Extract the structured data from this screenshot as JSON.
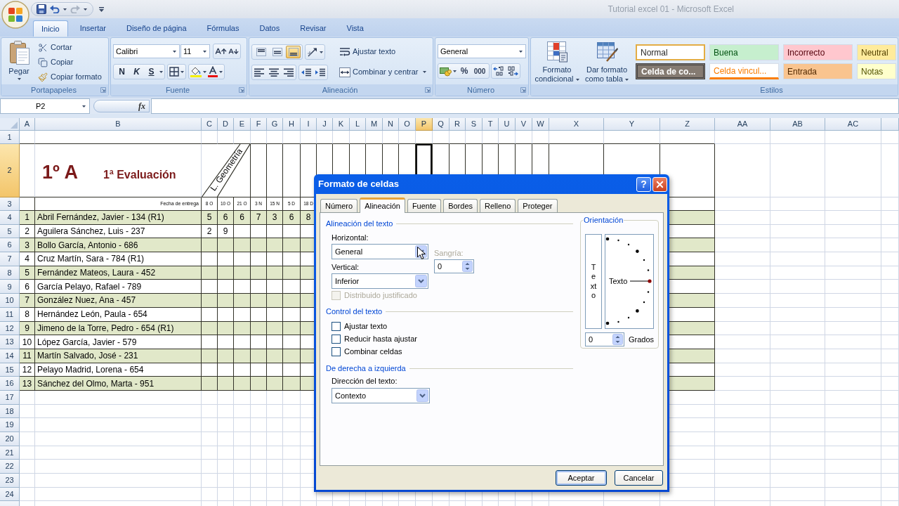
{
  "window": {
    "title": "Tutorial excel 01 - Microsoft Excel"
  },
  "ribbon_tabs": [
    {
      "label": "Inicio",
      "selected": true
    },
    {
      "label": "Insertar",
      "selected": false
    },
    {
      "label": "Diseño de página",
      "selected": false
    },
    {
      "label": "Fórmulas",
      "selected": false
    },
    {
      "label": "Datos",
      "selected": false
    },
    {
      "label": "Revisar",
      "selected": false
    },
    {
      "label": "Vista",
      "selected": false
    }
  ],
  "ribbon": {
    "clipboard": {
      "label": "Portapapeles",
      "paste": "Pegar",
      "tools": [
        "Cortar",
        "Copiar",
        "Copiar formato"
      ]
    },
    "font": {
      "label": "Fuente",
      "font_name": "Calibri",
      "font_size": "11",
      "styles": [
        {
          "label": "N",
          "kind": "bold"
        },
        {
          "label": "K",
          "kind": "italic"
        },
        {
          "label": "S",
          "kind": "underline"
        }
      ]
    },
    "alignment": {
      "label": "Alineación",
      "vertical": [
        {
          "kind": "top",
          "selected": false
        },
        {
          "kind": "middle",
          "selected": false
        },
        {
          "kind": "bottom",
          "selected": true
        }
      ],
      "wrap_text": "Ajustar texto",
      "merge": "Combinar y centrar"
    },
    "number": {
      "label": "Número",
      "format": "General",
      "percent": "%",
      "thousands": "000"
    },
    "styles": {
      "label": "Estilos",
      "conditional": "Formato condicional",
      "as_table": "Dar formato como tabla",
      "cell_styles": [
        {
          "label": "Normal",
          "kind": "fill",
          "color": "#ffffff",
          "selected": true
        },
        {
          "label": "Buena",
          "kind": "fill",
          "color": "#c6efce",
          "selected": false
        },
        {
          "label": "Incorrecto",
          "kind": "fill",
          "color": "#ffc7ce",
          "selected": false
        },
        {
          "label": "Neutral",
          "kind": "fill",
          "color": "#ffeb9c",
          "selected": false
        },
        {
          "label": "Celda de co...",
          "kind": "check",
          "color": "#857b72",
          "selected": false
        },
        {
          "label": "Celda vincul...",
          "kind": "linked",
          "color": "#fa7d00",
          "selected": false
        },
        {
          "label": "Entrada",
          "kind": "fill",
          "color": "#f9c48f",
          "selected": false
        },
        {
          "label": "Notas",
          "kind": "fill",
          "color": "#ffffcc",
          "selected": false
        }
      ]
    }
  },
  "formula_bar": {
    "name_box": "P2",
    "function_button": "fx"
  },
  "sheet": {
    "columns": [
      {
        "label": "A",
        "selected": false
      },
      {
        "label": "B",
        "selected": false
      },
      {
        "label": "C",
        "selected": false
      },
      {
        "label": "D",
        "selected": false
      },
      {
        "label": "E",
        "selected": false
      },
      {
        "label": "F",
        "selected": false
      },
      {
        "label": "G",
        "selected": false
      },
      {
        "label": "H",
        "selected": false
      },
      {
        "label": "I",
        "selected": false
      },
      {
        "label": "J",
        "selected": false
      },
      {
        "label": "K",
        "selected": false
      },
      {
        "label": "L",
        "selected": false
      },
      {
        "label": "M",
        "selected": false
      },
      {
        "label": "N",
        "selected": false
      },
      {
        "label": "O",
        "selected": false
      },
      {
        "label": "P",
        "selected": true
      },
      {
        "label": "Q",
        "selected": false
      },
      {
        "label": "R",
        "selected": false
      },
      {
        "label": "S",
        "selected": false
      },
      {
        "label": "T",
        "selected": false
      },
      {
        "label": "U",
        "selected": false
      },
      {
        "label": "V",
        "selected": false
      },
      {
        "label": "W",
        "selected": false
      },
      {
        "label": "X",
        "selected": false
      },
      {
        "label": "Y",
        "selected": false
      },
      {
        "label": "Z",
        "selected": false
      },
      {
        "label": "AA",
        "selected": false
      },
      {
        "label": "AB",
        "selected": false
      },
      {
        "label": "AC",
        "selected": false
      }
    ],
    "rows": [
      {
        "label": "1",
        "selected": false
      },
      {
        "label": "2",
        "selected": true
      },
      {
        "label": "3",
        "selected": false
      },
      {
        "label": "4",
        "selected": false
      },
      {
        "label": "5",
        "selected": false
      },
      {
        "label": "6",
        "selected": false
      },
      {
        "label": "7",
        "selected": false
      },
      {
        "label": "8",
        "selected": false
      },
      {
        "label": "9",
        "selected": false
      },
      {
        "label": "10",
        "selected": false
      },
      {
        "label": "11",
        "selected": false
      },
      {
        "label": "12",
        "selected": false
      },
      {
        "label": "13",
        "selected": false
      },
      {
        "label": "14",
        "selected": false
      },
      {
        "label": "15",
        "selected": false
      },
      {
        "label": "16",
        "selected": false
      },
      {
        "label": "17",
        "selected": false
      },
      {
        "label": "18",
        "selected": false
      },
      {
        "label": "19",
        "selected": false
      },
      {
        "label": "20",
        "selected": false
      },
      {
        "label": "21",
        "selected": false
      },
      {
        "label": "22",
        "selected": false
      },
      {
        "label": "23",
        "selected": false
      },
      {
        "label": "24",
        "selected": false
      }
    ],
    "title": {
      "group": "1º A",
      "term": "1ª Evaluación",
      "subject": "L. Geometría"
    },
    "date_caption": "Fecha de entrega",
    "dates": [
      "8 O",
      "10 O",
      "21 O",
      "3 N",
      "15 N",
      "5 D",
      "18 D"
    ],
    "students": [
      {
        "number": "1",
        "name": "Abril Fernández, Javier - 134 (R1)",
        "marks": [
          "5",
          "6",
          "6",
          "7",
          "3",
          "6",
          "8"
        ],
        "shaded": true
      },
      {
        "number": "2",
        "name": "Aguilera Sánchez, Luis - 237",
        "marks": [
          "2",
          "9"
        ],
        "shaded": false
      },
      {
        "number": "3",
        "name": "Bollo García, Antonio - 686",
        "shaded": true
      },
      {
        "number": "4",
        "name": "Cruz Martín, Sara - 784 (R1)",
        "shaded": false
      },
      {
        "number": "5",
        "name": "Fernández Mateos, Laura - 452",
        "shaded": true
      },
      {
        "number": "6",
        "name": "García Pelayo, Rafael - 789",
        "shaded": false
      },
      {
        "number": "7",
        "name": "González Nuez, Ana - 457",
        "shaded": true
      },
      {
        "number": "8",
        "name": "Hernández León, Paula - 654",
        "shaded": false
      },
      {
        "number": "9",
        "name": "Jimeno de la Torre, Pedro - 654 (R1)",
        "shaded": true
      },
      {
        "number": "10",
        "name": "López García, Javier - 579",
        "shaded": false
      },
      {
        "number": "11",
        "name": "Martín Salvado, José - 231",
        "shaded": true
      },
      {
        "number": "12",
        "name": "Pelayo Madrid, Lorena - 654",
        "shaded": false
      },
      {
        "number": "13",
        "name": "Sánchez del Olmo, Marta - 951",
        "shaded": true
      }
    ]
  },
  "dialog": {
    "title": "Formato de celdas",
    "help": "?",
    "tabs": [
      {
        "label": "Número",
        "selected": false
      },
      {
        "label": "Alineación",
        "selected": true
      },
      {
        "label": "Fuente",
        "selected": false
      },
      {
        "label": "Bordes",
        "selected": false
      },
      {
        "label": "Relleno",
        "selected": false
      },
      {
        "label": "Proteger",
        "selected": false
      }
    ],
    "text_alignment": {
      "heading": "Alineación del texto",
      "horizontal_label": "Horizontal:",
      "horizontal": "General",
      "vertical_label": "Vertical:",
      "vertical": "Inferior",
      "indent": {
        "label": "Sangría:",
        "value": "0",
        "disabled": true
      },
      "distributed": {
        "label": "Distribuido justificado",
        "checked": false,
        "disabled": true
      }
    },
    "text_control": {
      "heading": "Control del texto",
      "options": [
        {
          "label": "Ajustar texto",
          "checked": false
        },
        {
          "label": "Reducir hasta ajustar",
          "checked": false
        },
        {
          "label": "Combinar celdas",
          "checked": false
        }
      ]
    },
    "direction": {
      "heading": "De derecha a izquierda",
      "label": "Dirección del texto:",
      "value": "Contexto"
    },
    "orientation": {
      "heading": "Orientación",
      "vertical_text": "Texto",
      "dial_text": "Texto",
      "degrees": "0",
      "degrees_label": "Grados"
    },
    "buttons": [
      {
        "label": "Aceptar",
        "default": true
      },
      {
        "label": "Cancelar",
        "default": false
      }
    ]
  }
}
